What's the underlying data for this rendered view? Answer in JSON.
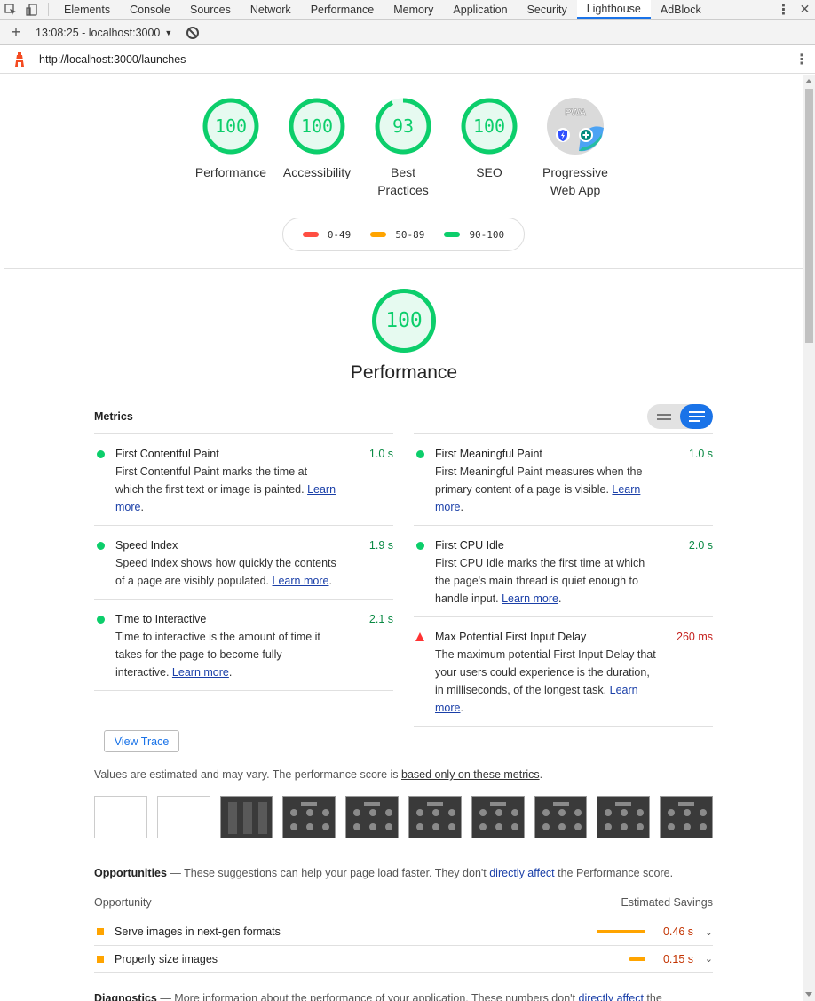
{
  "devtools": {
    "tabs": [
      "Elements",
      "Console",
      "Sources",
      "Network",
      "Performance",
      "Memory",
      "Application",
      "Security",
      "Lighthouse",
      "AdBlock"
    ],
    "active_tab": "Lighthouse"
  },
  "toolbar": {
    "report_select": "13:08:25 - localhost:3000"
  },
  "urlbar": {
    "url": "http://localhost:3000/launches"
  },
  "categories": [
    {
      "score": "100",
      "label": "Performance",
      "value": 100
    },
    {
      "score": "100",
      "label": "Accessibility",
      "value": 100
    },
    {
      "score": "93",
      "label": "Best Practices",
      "value": 93
    },
    {
      "score": "100",
      "label": "SEO",
      "value": 100
    },
    {
      "score": "PWA",
      "label": "Progressive Web App"
    }
  ],
  "legend": [
    {
      "range": "0-49",
      "color": "#ff4e42"
    },
    {
      "range": "50-89",
      "color": "#ffa400"
    },
    {
      "range": "90-100",
      "color": "#0cce6b"
    }
  ],
  "performance": {
    "score": "100",
    "title": "Performance"
  },
  "metrics_title": "Metrics",
  "metrics": {
    "fcp": {
      "name": "First Contentful Paint",
      "value": "1.0 s",
      "desc": "First Contentful Paint marks the time at which the first text or image is painted. ",
      "link": "Learn more"
    },
    "si": {
      "name": "Speed Index",
      "value": "1.9 s",
      "desc": "Speed Index shows how quickly the contents of a page are visibly populated. ",
      "link": "Learn more"
    },
    "tti": {
      "name": "Time to Interactive",
      "value": "2.1 s",
      "desc": "Time to interactive is the amount of time it takes for the page to become fully interactive. ",
      "link": "Learn more"
    },
    "fmp": {
      "name": "First Meaningful Paint",
      "value": "1.0 s",
      "desc": "First Meaningful Paint measures when the primary content of a page is visible. ",
      "link": "Learn more"
    },
    "cpu": {
      "name": "First CPU Idle",
      "value": "2.0 s",
      "desc": "First CPU Idle marks the first time at which the page's main thread is quiet enough to handle input. ",
      "link": "Learn more"
    },
    "mpfid": {
      "name": "Max Potential First Input Delay",
      "value": "260 ms",
      "desc": "The maximum potential First Input Delay that your users could experience is the duration, in milliseconds, of the longest task. ",
      "link": "Learn more"
    }
  },
  "view_trace": "View Trace",
  "values_note": {
    "text": "Values are estimated and may vary. The performance score is ",
    "link": "based only on these metrics",
    "end": "."
  },
  "opportunities": {
    "title": "Opportunities",
    "desc_pre": " — These suggestions can help your page load faster. They don't ",
    "link": "directly affect",
    "desc_post": " the Performance score.",
    "col_left": "Opportunity",
    "col_right": "Estimated Savings",
    "items": [
      {
        "name": "Serve images in next-gen formats",
        "savings": "0.46 s",
        "fraction": 0.46
      },
      {
        "name": "Properly size images",
        "savings": "0.15 s",
        "fraction": 0.15
      }
    ]
  },
  "diagnostics": {
    "title": "Diagnostics",
    "desc_pre": " — More information about the performance of your application. These numbers don't ",
    "link": "directly affect",
    "desc_post": " the"
  }
}
